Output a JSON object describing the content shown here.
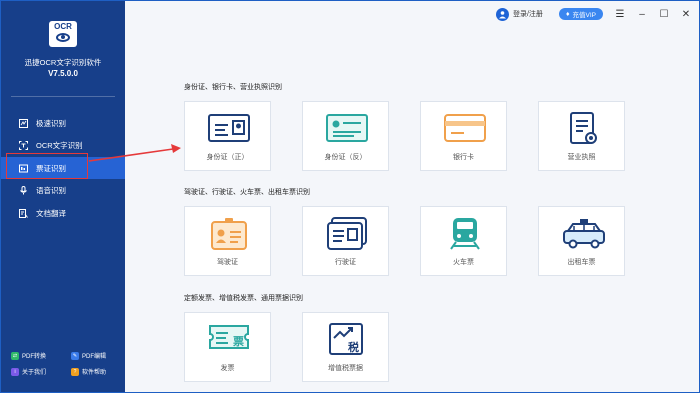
{
  "app": {
    "logo_text": "OCR",
    "name": "迅捷OCR文字识别软件",
    "version": "V7.5.0.0"
  },
  "nav": [
    {
      "label": "极速识别",
      "icon": "quick-scan-icon"
    },
    {
      "label": "OCR文字识别",
      "icon": "ocr-frame-icon"
    },
    {
      "label": "票证识别",
      "icon": "ticket-icon"
    },
    {
      "label": "语音识别",
      "icon": "microphone-icon"
    },
    {
      "label": "文档翻译",
      "icon": "translate-icon"
    }
  ],
  "bottom_links": [
    {
      "label": "PDF转换",
      "icon": "pdf-convert-icon",
      "color": "#2fb86a"
    },
    {
      "label": "PDF编辑",
      "icon": "pdf-edit-icon",
      "color": "#3a7bea"
    },
    {
      "label": "关于我们",
      "icon": "about-icon",
      "color": "#7a5ae8"
    },
    {
      "label": "软件帮助",
      "icon": "help-icon",
      "color": "#f0a020"
    }
  ],
  "topbar": {
    "login_label": "登录/注册",
    "vip_label": "充值VIP"
  },
  "sections": [
    {
      "title": "身份证、银行卡、营业执照识别",
      "cards": [
        {
          "label": "身份证（正）",
          "icon": "id-card-front-icon"
        },
        {
          "label": "身份证（反）",
          "icon": "id-card-back-icon"
        },
        {
          "label": "银行卡",
          "icon": "bank-card-icon"
        },
        {
          "label": "营业执照",
          "icon": "business-license-icon"
        }
      ]
    },
    {
      "title": "驾驶证、行驶证、火车票、出租车票识别",
      "cards": [
        {
          "label": "驾驶证",
          "icon": "driver-license-icon"
        },
        {
          "label": "行驶证",
          "icon": "vehicle-license-icon"
        },
        {
          "label": "火车票",
          "icon": "train-ticket-icon"
        },
        {
          "label": "出租车票",
          "icon": "taxi-ticket-icon"
        }
      ]
    },
    {
      "title": "定额发票、增值税发票、通用票据识别",
      "cards": [
        {
          "label": "发票",
          "icon": "invoice-icon"
        },
        {
          "label": "增值税票据",
          "icon": "vat-invoice-icon"
        }
      ]
    }
  ],
  "colors": {
    "sidebar": "#173f8a",
    "active": "#2663d4",
    "accent": "#1e5fc4",
    "highlight": "#e5393a"
  }
}
